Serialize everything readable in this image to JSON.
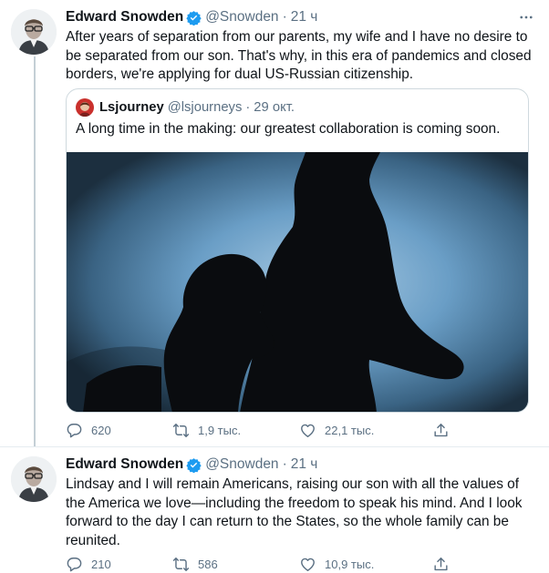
{
  "tweet1": {
    "name": "Edward Snowden",
    "handle": "@Snowden",
    "dot": "·",
    "time": "21 ч",
    "text": "After years of separation from our parents, my wife and I have no desire to be separated from our son. That's why, in this era of pandemics and closed borders, we're applying for dual US-Russian citizenship.",
    "quote": {
      "name": "Lsjourney",
      "handle": "@lsjourneys",
      "dot": "·",
      "time": "29 окт.",
      "text": "A long time in the making: our greatest collaboration is coming soon."
    },
    "actions": {
      "replies": "620",
      "retweets": "1,9 тыс.",
      "likes": "22,1 тыс."
    }
  },
  "tweet2": {
    "name": "Edward Snowden",
    "handle": "@Snowden",
    "dot": "·",
    "time": "21 ч",
    "text": "Lindsay and I will remain Americans, raising our son with all the values of the America we love—including the freedom to speak his mind. And I look forward to the day I can return to the States, so the whole family can be reunited.",
    "actions": {
      "replies": "210",
      "retweets": "586",
      "likes": "10,9 тыс."
    }
  },
  "icons": {
    "verified": "verified-badge-icon",
    "more": "more-icon",
    "reply": "reply-icon",
    "retweet": "retweet-icon",
    "like": "like-icon",
    "share": "share-icon"
  },
  "colors": {
    "verified": "#1d9bf0",
    "secondary_text": "#5b7083",
    "border": "#cfd9de",
    "image_bg": "#6a9ec6"
  }
}
